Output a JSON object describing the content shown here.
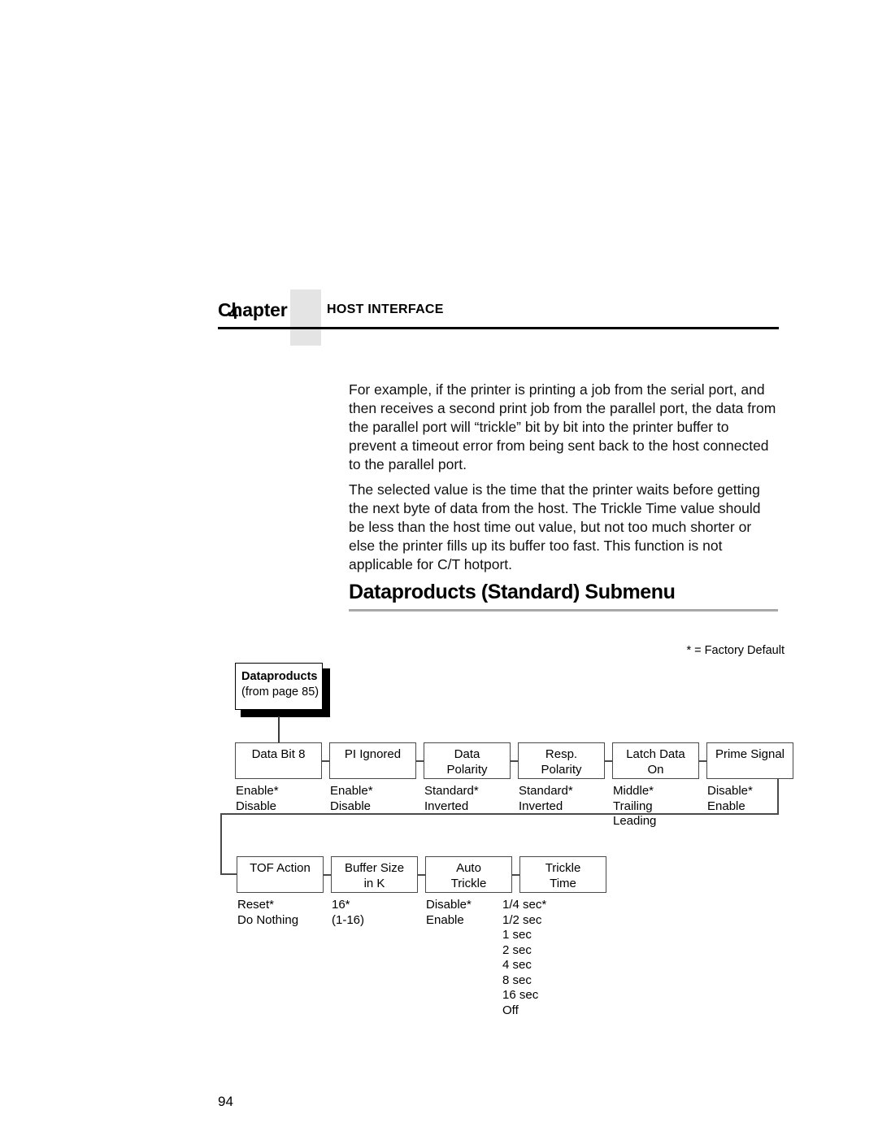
{
  "header": {
    "chapter_word": "Chapter",
    "chapter_number": "4",
    "chapter_title": "HOST INTERFACE"
  },
  "body": {
    "paragraph_1": "For example, if the printer is printing a job from the serial port, and then receives a second print job from the parallel port, the data from the parallel port will “trickle” bit by bit into the printer buffer to prevent a timeout error from being sent back to the host connected to the parallel port.",
    "paragraph_2": "The selected value is the time that the printer waits before getting the next byte of data from the host. The Trickle Time value should be less than the host time out value, but not too much shorter or else the printer fills up its buffer too fast. This function is not applicable for C/T hotport."
  },
  "section": {
    "heading": "Dataproducts (Standard) Submenu"
  },
  "diagram": {
    "factory_default_note": "* = Factory Default",
    "source_box": {
      "title": "Dataproducts",
      "subtitle": "(from page 85)"
    },
    "row1": [
      {
        "title_lines": [
          "Data Bit 8"
        ],
        "options": [
          "Enable*",
          "Disable"
        ]
      },
      {
        "title_lines": [
          "PI Ignored"
        ],
        "options": [
          "Enable*",
          "Disable"
        ]
      },
      {
        "title_lines": [
          "Data",
          "Polarity"
        ],
        "options": [
          "Standard*",
          "Inverted"
        ]
      },
      {
        "title_lines": [
          "Resp.",
          "Polarity"
        ],
        "options": [
          "Standard*",
          "Inverted"
        ]
      },
      {
        "title_lines": [
          "Latch Data",
          "On"
        ],
        "options": [
          "Middle*",
          "Trailing",
          "Leading"
        ]
      },
      {
        "title_lines": [
          "Prime Signal"
        ],
        "options": [
          "Disable*",
          "Enable"
        ]
      }
    ],
    "row2": [
      {
        "title_lines": [
          "TOF Action"
        ],
        "options": [
          "Reset*",
          "Do Nothing"
        ]
      },
      {
        "title_lines": [
          "Buffer Size",
          "in K"
        ],
        "options": [
          "16*",
          "(1-16)"
        ]
      },
      {
        "title_lines": [
          "Auto",
          "Trickle"
        ],
        "options": [
          "Disable*",
          "Enable"
        ]
      },
      {
        "title_lines": [
          "Trickle",
          "Time"
        ],
        "options": [
          "1/4 sec*",
          "1/2 sec",
          "1 sec",
          "2 sec",
          "4 sec",
          "8 sec",
          "16 sec",
          "Off"
        ]
      }
    ]
  },
  "footer": {
    "page_number": "94"
  }
}
